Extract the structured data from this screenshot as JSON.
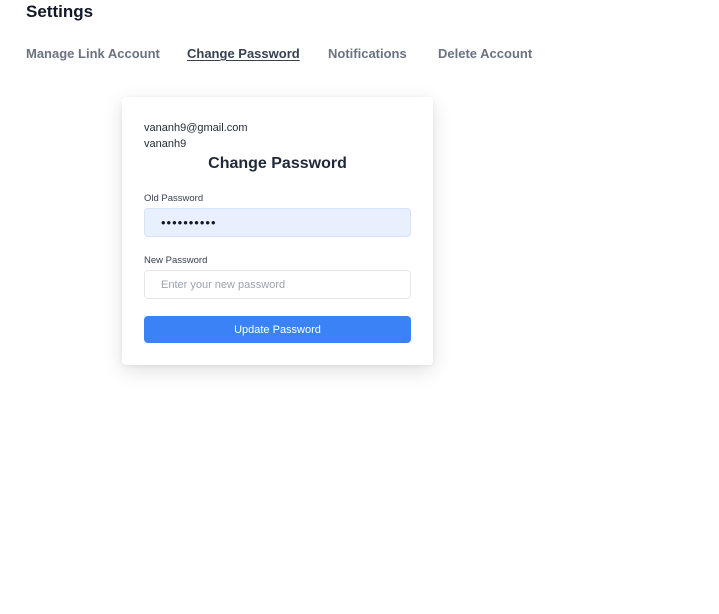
{
  "header": {
    "title": "Settings"
  },
  "tabs": [
    {
      "label": "Manage Link Account",
      "active": false
    },
    {
      "label": "Change Password",
      "active": true
    },
    {
      "label": "Notifications",
      "active": false
    },
    {
      "label": "Delete Account",
      "active": false
    }
  ],
  "card": {
    "email": "vananh9@gmail.com",
    "username": "vananh9",
    "title": "Change Password",
    "old_password": {
      "label": "Old Password",
      "value": "••••••••••"
    },
    "new_password": {
      "label": "New Password",
      "placeholder": "Enter your new password",
      "value": ""
    },
    "submit_label": "Update Password"
  },
  "colors": {
    "accent": "#3b82f6",
    "autofill_bg": "#e8f0fe",
    "tab_text": "#6b7280"
  }
}
